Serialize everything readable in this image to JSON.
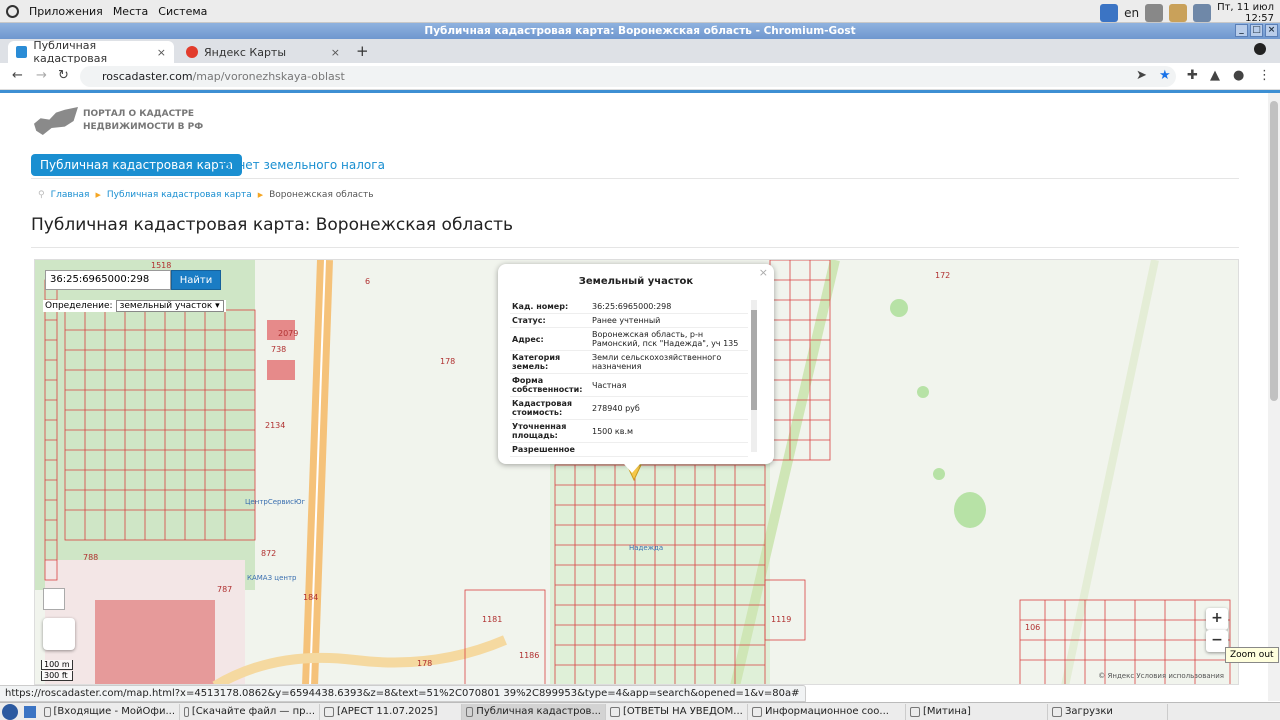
{
  "system": {
    "menus": [
      "Приложения",
      "Места",
      "Система"
    ],
    "lang": "en",
    "clock_date": "Пт, 11 июл",
    "clock_time": "12:57"
  },
  "window": {
    "title": "Публичная кадастровая карта: Воронежская область - Chromium-Gost"
  },
  "tabs": [
    {
      "label": "Публичная кадастровая"
    },
    {
      "label": "Яндекс Карты"
    }
  ],
  "address": {
    "host": "roscadaster.com",
    "path": "/map/voronezhskaya-oblast"
  },
  "site": {
    "logo_line1": "ПОРТАЛ О КАДАСТРЕ",
    "logo_line2": "НЕДВИЖИМОСТИ В РФ",
    "nav": [
      "Публичная кадастровая карта",
      "Расчет земельного налога"
    ],
    "breadcrumbs": [
      "Главная",
      "Публичная кадастровая карта",
      "Воронежская область"
    ],
    "heading": "Публичная кадастровая карта: Воронежская область"
  },
  "map": {
    "search_value": "36:25:6965000:298",
    "search_button": "Найти",
    "definition_label": "Определение:",
    "definition_value": "земельный участок",
    "scale_1": "100 m",
    "scale_2": "300 ft",
    "copyright": "© Яндекс Условия использования",
    "labels": [
      "172",
      "178",
      "2134",
      "738",
      "2079",
      "788",
      "787",
      "872",
      "1186",
      "1181",
      "1119",
      "106",
      "184",
      "178",
      "6",
      "1518",
      "ЦентрСервисЮг",
      "КАМАЗ центр",
      "Надежда"
    ]
  },
  "popup": {
    "title": "Земельный участок",
    "rows": [
      {
        "k": "Кад. номер:",
        "v": "36:25:6965000:298"
      },
      {
        "k": "Статус:",
        "v": "Ранее учтенный"
      },
      {
        "k": "Адрес:",
        "v": "Воронежская область, р-н Рамонский, пск \"Надежда\", уч 135"
      },
      {
        "k": "Категория земель:",
        "v": "Земли сельскохозяйственного назначения"
      },
      {
        "k": "Форма собственности:",
        "v": "Частная"
      },
      {
        "k": "Кадастровая стоимость:",
        "v": "278940 руб"
      },
      {
        "k": "Уточненная площадь:",
        "v": "1500 кв.м"
      },
      {
        "k": "Разрешенное",
        "v": ""
      }
    ]
  },
  "zoom": {
    "in": "+",
    "out": "−",
    "tooltip": "Zoom out"
  },
  "status_url": "https://roscadaster.com/map.html?x=4513178.0862&y=6594438.6393&z=8&text=51%2C070801 39%2C899953&type=4&app=search&opened=1&v=80a#",
  "taskbar": [
    "[Входящие - МойОфи...",
    "[Скачайте файл — пр...",
    "[АРЕСТ 11.07.2025]",
    "Публичная кадастров...",
    "[ОТВЕТЫ НА УВЕДОМ...",
    "Информационное соо...",
    "[Митина]",
    "Загрузки"
  ]
}
